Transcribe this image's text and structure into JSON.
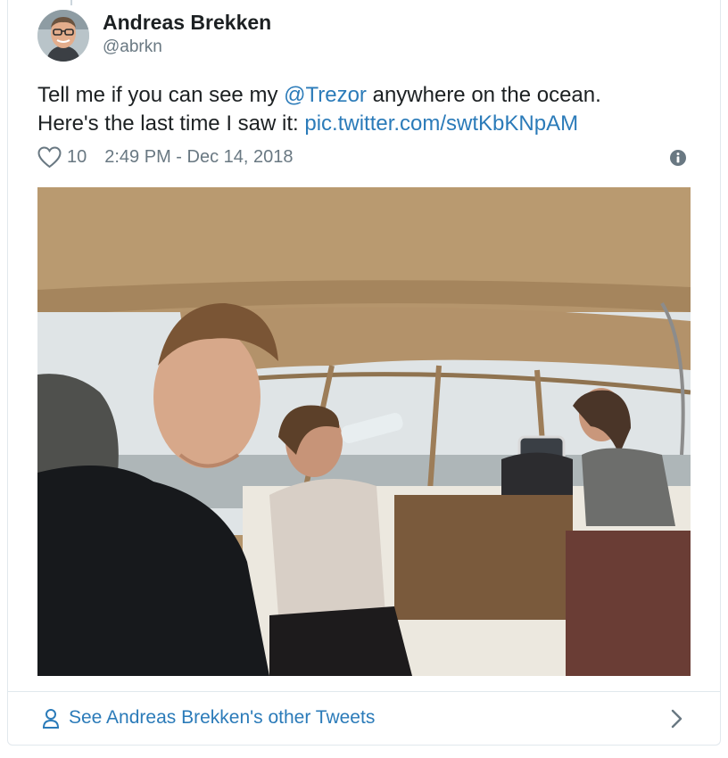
{
  "author": {
    "display_name": "Andreas Brekken",
    "screen_name": "@abrkn"
  },
  "tweet": {
    "text_line1_prefix": "Tell me if you can see my ",
    "mention": "@Trezor",
    "text_line1_suffix": " anywhere on the ocean.",
    "text_line2_prefix": "Here's the last time I saw it: ",
    "link": "pic.twitter.com/swtKbKNpAM"
  },
  "meta": {
    "like_count": "10",
    "timestamp": "2:49 PM - Dec 14, 2018"
  },
  "media": {
    "kind": "photo"
  },
  "footer": {
    "label": "See Andreas Brekken's other Tweets"
  },
  "icons": {
    "heart": "heart-icon",
    "info": "info-icon",
    "person": "person-icon",
    "chevron": "chevron-right-icon"
  },
  "colors": {
    "link": "#2b7bb9",
    "muted": "#697882",
    "text": "#1c2022",
    "border": "#e1e8ed"
  }
}
